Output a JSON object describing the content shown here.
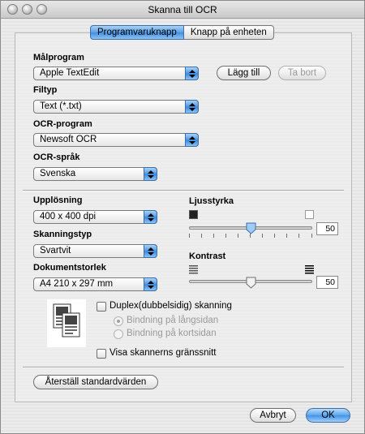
{
  "window": {
    "title": "Skanna till OCR"
  },
  "tabs": [
    {
      "label": "Programvaruknapp",
      "selected": true
    },
    {
      "label": "Knapp på enheten",
      "selected": false
    }
  ],
  "target_app": {
    "label": "Målprogram",
    "value": "Apple TextEdit",
    "add_button": "Lägg till",
    "remove_button": "Ta bort"
  },
  "file_type": {
    "label": "Filtyp",
    "value": "Text (*.txt)"
  },
  "ocr_program": {
    "label": "OCR-program",
    "value": "Newsoft OCR"
  },
  "ocr_language": {
    "label": "OCR-språk",
    "value": "Svenska"
  },
  "resolution": {
    "label": "Upplösning",
    "value": "400 x 400 dpi"
  },
  "scan_type": {
    "label": "Skanningstyp",
    "value": "Svartvit"
  },
  "document_size": {
    "label": "Dokumentstorlek",
    "value": "A4  210 x 297 mm"
  },
  "brightness": {
    "label": "Ljusstyrka",
    "value": "50",
    "level": 0.5
  },
  "contrast": {
    "label": "Kontrast",
    "value": "50",
    "level": 0.5
  },
  "duplex": {
    "label": "Duplex(dubbelsidig) skanning",
    "checked": false,
    "options": [
      {
        "label": "Bindning på långsidan",
        "selected": true
      },
      {
        "label": "Bindning på kortsidan",
        "selected": false
      }
    ]
  },
  "show_scanner_interface": {
    "label": "Visa skannerns gränssnitt",
    "checked": false
  },
  "buttons": {
    "restore_defaults": "Återställ standardvärden",
    "cancel": "Avbryt",
    "ok": "OK"
  }
}
